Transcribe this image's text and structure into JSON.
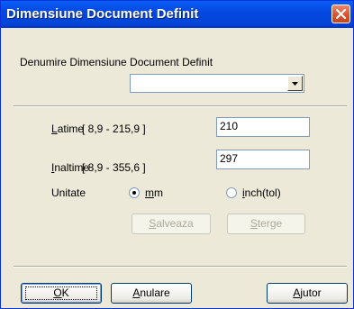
{
  "window": {
    "title": "Dimensiune Document Definit"
  },
  "dialog": {
    "name_label": "Denumire Dimensiune Document Definit",
    "name_combo_value": "",
    "width": {
      "mnemonic": "L",
      "label_rest": "atime",
      "range": "[  8,9 - 215,9 ]",
      "value": "210"
    },
    "height": {
      "mnemonic": "I",
      "label_rest": "naltime",
      "range": "[  8,9 - 355,6 ]",
      "value": "297"
    },
    "unit": {
      "label": "Unitate",
      "mm": {
        "mnemonic": "m",
        "rest": "m",
        "selected": true
      },
      "inch": {
        "mnemonic": "i",
        "rest": "nch(tol)",
        "selected": false
      }
    },
    "save": {
      "mnemonic": "S",
      "rest": "alveaza"
    },
    "delete": {
      "mnemonic": "S",
      "rest": "terge"
    }
  },
  "footer": {
    "ok": {
      "mnemonic": "O",
      "rest": "K"
    },
    "cancel": {
      "mnemonic": "A",
      "rest": "nulare"
    },
    "help": {
      "mnemonic": "A",
      "rest": "jutor"
    }
  }
}
